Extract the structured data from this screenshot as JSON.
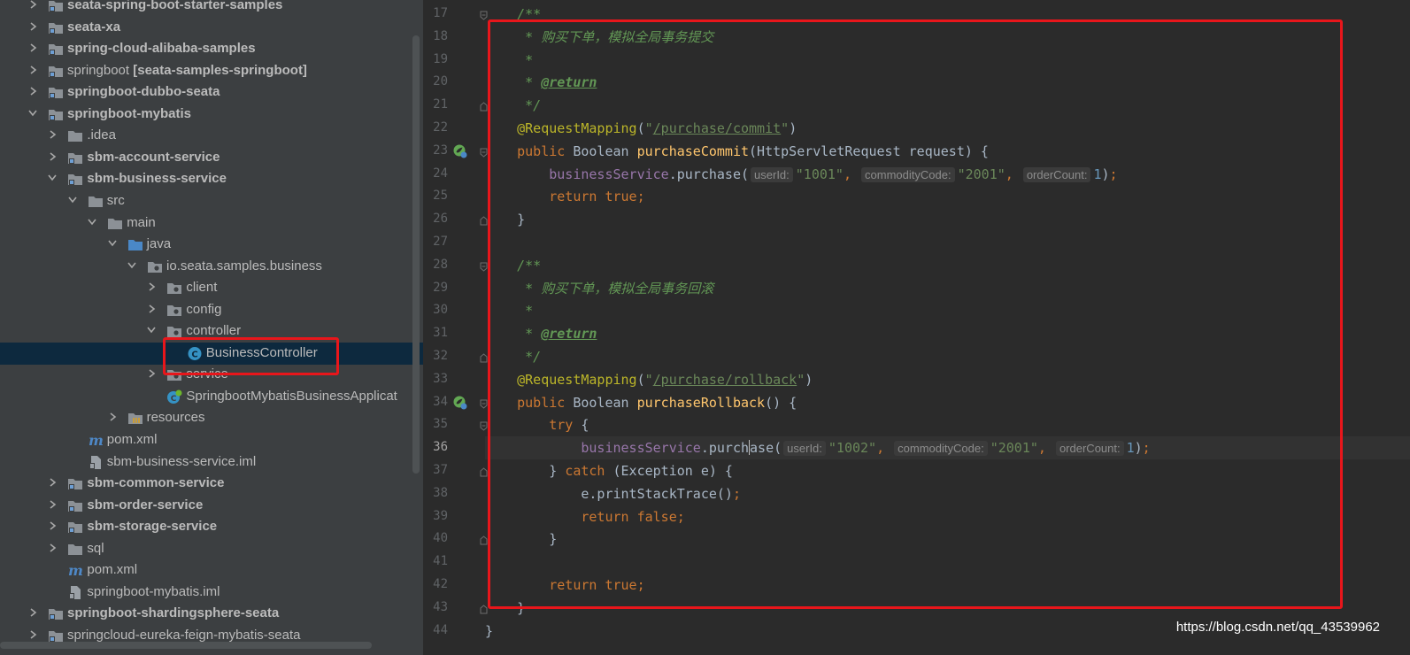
{
  "project_tree": {
    "items": [
      {
        "label": "seata-spring-boot-starter-samples",
        "bold": true,
        "icon": "module-folder-icon",
        "chevron": "right"
      },
      {
        "label": "seata-xa",
        "bold": true,
        "icon": "module-folder-icon",
        "chevron": "right"
      },
      {
        "label": "spring-cloud-alibaba-samples",
        "bold": true,
        "icon": "module-folder-icon",
        "chevron": "right"
      },
      {
        "label": "springboot",
        "suffix": "[seata-samples-springboot]",
        "bold": false,
        "icon": "module-folder-icon",
        "chevron": "right"
      },
      {
        "label": "springboot-dubbo-seata",
        "bold": true,
        "icon": "module-folder-icon",
        "chevron": "right"
      },
      {
        "label": "springboot-mybatis",
        "bold": true,
        "icon": "module-folder-icon",
        "chevron": "down"
      },
      {
        "label": ".idea",
        "bold": false,
        "icon": "folder-icon",
        "chevron": "right"
      },
      {
        "label": "sbm-account-service",
        "bold": true,
        "icon": "module-folder-icon",
        "chevron": "right"
      },
      {
        "label": "sbm-business-service",
        "bold": true,
        "icon": "module-folder-icon",
        "chevron": "down"
      },
      {
        "label": "src",
        "bold": false,
        "icon": "folder-icon",
        "chevron": "down"
      },
      {
        "label": "main",
        "bold": false,
        "icon": "folder-icon",
        "chevron": "down"
      },
      {
        "label": "java",
        "bold": false,
        "icon": "source-folder-icon",
        "chevron": "down"
      },
      {
        "label": "io.seata.samples.business",
        "bold": false,
        "icon": "package-icon",
        "chevron": "down"
      },
      {
        "label": "client",
        "bold": false,
        "icon": "package-icon",
        "chevron": "right"
      },
      {
        "label": "config",
        "bold": false,
        "icon": "package-icon",
        "chevron": "right"
      },
      {
        "label": "controller",
        "bold": false,
        "icon": "package-icon",
        "chevron": "down"
      },
      {
        "label": "BusinessController",
        "bold": false,
        "icon": "java-class-icon",
        "chevron": "none",
        "selected": true
      },
      {
        "label": "service",
        "bold": false,
        "icon": "package-icon",
        "chevron": "right"
      },
      {
        "label": "SpringbootMybatisBusinessApplicat",
        "bold": false,
        "icon": "spring-boot-class-icon",
        "chevron": "none"
      },
      {
        "label": "resources",
        "bold": false,
        "icon": "resources-folder-icon",
        "chevron": "right"
      },
      {
        "label": "pom.xml",
        "bold": false,
        "icon": "maven-icon",
        "chevron": "none"
      },
      {
        "label": "sbm-business-service.iml",
        "bold": false,
        "icon": "iml-file-icon",
        "chevron": "none"
      },
      {
        "label": "sbm-common-service",
        "bold": true,
        "icon": "module-folder-icon",
        "chevron": "right"
      },
      {
        "label": "sbm-order-service",
        "bold": true,
        "icon": "module-folder-icon",
        "chevron": "right"
      },
      {
        "label": "sbm-storage-service",
        "bold": true,
        "icon": "module-folder-icon",
        "chevron": "right"
      },
      {
        "label": "sql",
        "bold": false,
        "icon": "folder-icon",
        "chevron": "right"
      },
      {
        "label": "pom.xml",
        "bold": false,
        "icon": "maven-icon",
        "chevron": "none"
      },
      {
        "label": "springboot-mybatis.iml",
        "bold": false,
        "icon": "iml-file-icon",
        "chevron": "none"
      },
      {
        "label": "springboot-shardingsphere-seata",
        "bold": true,
        "icon": "module-folder-icon",
        "chevron": "right"
      },
      {
        "label": "springcloud-eureka-feign-mybatis-seata",
        "bold": false,
        "icon": "module-folder-icon",
        "chevron": "right"
      }
    ]
  },
  "editor": {
    "current_line": 36,
    "lines": [
      {
        "n": 17,
        "fold": "open",
        "tokens": [
          {
            "c": "cm",
            "t": "    /**"
          }
        ]
      },
      {
        "n": 18,
        "tokens": [
          {
            "c": "cm",
            "t": "     * 购买下单，模拟全局事务提交"
          }
        ]
      },
      {
        "n": 19,
        "tokens": [
          {
            "c": "cm",
            "t": "     *"
          }
        ]
      },
      {
        "n": 20,
        "tokens": [
          {
            "c": "cm",
            "t": "     * "
          },
          {
            "c": "cmtag",
            "t": "@return"
          }
        ]
      },
      {
        "n": 21,
        "fold": "close",
        "tokens": [
          {
            "c": "cm",
            "t": "     */"
          }
        ]
      },
      {
        "n": 22,
        "tokens": [
          {
            "c": "an",
            "t": "    @RequestMapping"
          },
          {
            "c": "p",
            "t": "("
          },
          {
            "c": "str",
            "t": "\""
          },
          {
            "c": "url",
            "t": "/purchase/commit"
          },
          {
            "c": "str",
            "t": "\""
          },
          {
            "c": "p",
            "t": ")"
          }
        ]
      },
      {
        "n": 23,
        "fold": "open",
        "gutter": "spring-endpoint-icon",
        "tokens": [
          {
            "c": "kw",
            "t": "    public "
          },
          {
            "c": "p",
            "t": "Boolean "
          },
          {
            "c": "fn",
            "t": "purchaseCommit"
          },
          {
            "c": "p",
            "t": "(HttpServletRequest request) {"
          }
        ]
      },
      {
        "n": 24,
        "tokens": [
          {
            "c": "fld",
            "t": "        businessService"
          },
          {
            "c": "p",
            "t": "."
          },
          {
            "c": "mcall",
            "t": "purchase"
          },
          {
            "c": "p",
            "t": "("
          },
          {
            "c": "hint",
            "t": "userId:"
          },
          {
            "c": "str",
            "t": "\"1001\""
          },
          {
            "c": "kw",
            "t": ", "
          },
          {
            "c": "hint",
            "t": "commodityCode:"
          },
          {
            "c": "str",
            "t": "\"2001\""
          },
          {
            "c": "kw",
            "t": ", "
          },
          {
            "c": "hint",
            "t": "orderCount:"
          },
          {
            "c": "num",
            "t": "1"
          },
          {
            "c": "p",
            "t": ")"
          },
          {
            "c": "kw",
            "t": ";"
          }
        ]
      },
      {
        "n": 25,
        "tokens": [
          {
            "c": "kw",
            "t": "        return true;"
          }
        ]
      },
      {
        "n": 26,
        "fold": "close",
        "tokens": [
          {
            "c": "p",
            "t": "    }"
          }
        ]
      },
      {
        "n": 27,
        "tokens": []
      },
      {
        "n": 28,
        "fold": "open",
        "tokens": [
          {
            "c": "cm",
            "t": "    /**"
          }
        ]
      },
      {
        "n": 29,
        "tokens": [
          {
            "c": "cm",
            "t": "     * 购买下单，模拟全局事务回滚"
          }
        ]
      },
      {
        "n": 30,
        "tokens": [
          {
            "c": "cm",
            "t": "     *"
          }
        ]
      },
      {
        "n": 31,
        "tokens": [
          {
            "c": "cm",
            "t": "     * "
          },
          {
            "c": "cmtag",
            "t": "@return"
          }
        ]
      },
      {
        "n": 32,
        "fold": "close",
        "tokens": [
          {
            "c": "cm",
            "t": "     */"
          }
        ]
      },
      {
        "n": 33,
        "tokens": [
          {
            "c": "an",
            "t": "    @RequestMapping"
          },
          {
            "c": "p",
            "t": "("
          },
          {
            "c": "str",
            "t": "\""
          },
          {
            "c": "url",
            "t": "/purchase/rollback"
          },
          {
            "c": "str",
            "t": "\""
          },
          {
            "c": "p",
            "t": ")"
          }
        ]
      },
      {
        "n": 34,
        "fold": "open",
        "gutter": "spring-endpoint-icon",
        "tokens": [
          {
            "c": "kw",
            "t": "    public "
          },
          {
            "c": "p",
            "t": "Boolean "
          },
          {
            "c": "fn",
            "t": "purchaseRollback"
          },
          {
            "c": "p",
            "t": "() {"
          }
        ]
      },
      {
        "n": 35,
        "fold": "open",
        "tokens": [
          {
            "c": "kw",
            "t": "        try "
          },
          {
            "c": "p",
            "t": "{"
          }
        ]
      },
      {
        "n": 36,
        "tokens": [
          {
            "c": "fld",
            "t": "            businessService"
          },
          {
            "c": "p",
            "t": "."
          },
          {
            "c": "mcall",
            "t": "purch"
          },
          {
            "c": "caret",
            "t": ""
          },
          {
            "c": "mcall",
            "t": "ase"
          },
          {
            "c": "p",
            "t": "("
          },
          {
            "c": "hint",
            "t": "userId:"
          },
          {
            "c": "str",
            "t": "\"1002\""
          },
          {
            "c": "kw",
            "t": ", "
          },
          {
            "c": "hint",
            "t": "commodityCode:"
          },
          {
            "c": "str",
            "t": "\"2001\""
          },
          {
            "c": "kw",
            "t": ", "
          },
          {
            "c": "hint",
            "t": "orderCount:"
          },
          {
            "c": "num",
            "t": "1"
          },
          {
            "c": "p",
            "t": ")"
          },
          {
            "c": "kw",
            "t": ";"
          }
        ]
      },
      {
        "n": 37,
        "fold": "close",
        "tokens": [
          {
            "c": "p",
            "t": "        } "
          },
          {
            "c": "kw",
            "t": "catch "
          },
          {
            "c": "p",
            "t": "(Exception e) {"
          }
        ]
      },
      {
        "n": 38,
        "tokens": [
          {
            "c": "p",
            "t": "            e.printStackTrace()"
          },
          {
            "c": "kw",
            "t": ";"
          }
        ]
      },
      {
        "n": 39,
        "tokens": [
          {
            "c": "kw",
            "t": "            return false;"
          }
        ]
      },
      {
        "n": 40,
        "fold": "close",
        "tokens": [
          {
            "c": "p",
            "t": "        }"
          }
        ]
      },
      {
        "n": 41,
        "tokens": []
      },
      {
        "n": 42,
        "tokens": [
          {
            "c": "kw",
            "t": "        return true;"
          }
        ]
      },
      {
        "n": 43,
        "fold": "close",
        "tokens": [
          {
            "c": "p",
            "t": "    }"
          }
        ]
      },
      {
        "n": 44,
        "tokens": [
          {
            "c": "p",
            "t": "}"
          }
        ]
      }
    ]
  },
  "watermark": "https://blog.csdn.net/qq_43539962",
  "colors": {
    "annotation_box": "#e8161b",
    "selection": "#0d293e",
    "tree_bg": "#3c3f41",
    "editor_bg": "#2b2b2b"
  }
}
